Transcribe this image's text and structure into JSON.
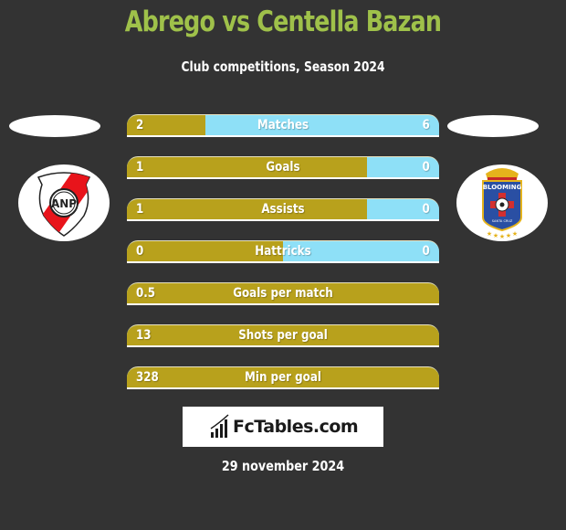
{
  "header": {
    "title": "Abrego vs Centella Bazan",
    "subtitle": "Club competitions, Season 2024"
  },
  "teams": {
    "left": {
      "crest_icon": "club-atletico-nacional-potosi-crest",
      "colors": {
        "primary": "#e8141b",
        "secondary": "#ffffff"
      }
    },
    "right": {
      "crest_icon": "blooming-crest",
      "text": "BLOOMING",
      "colors": {
        "primary": "#2a4fa3",
        "accent": "#d32f2f",
        "gold": "#e5b31c"
      }
    }
  },
  "colors": {
    "background": "#333333",
    "title": "#9fc14a",
    "left_bar": "#b8a11c",
    "right_bar": "#8ee0f7"
  },
  "stats": [
    {
      "label": "Matches",
      "left": "2",
      "right": "6",
      "left_share": 0.25
    },
    {
      "label": "Goals",
      "left": "1",
      "right": "0",
      "left_share": 0.77
    },
    {
      "label": "Assists",
      "left": "1",
      "right": "0",
      "left_share": 0.77
    },
    {
      "label": "Hattricks",
      "left": "0",
      "right": "0",
      "left_share": 0.5
    },
    {
      "label": "Goals per match",
      "left": "0.5",
      "right": "",
      "left_share": 1.0
    },
    {
      "label": "Shots per goal",
      "left": "13",
      "right": "",
      "left_share": 1.0
    },
    {
      "label": "Min per goal",
      "left": "328",
      "right": "",
      "left_share": 1.0
    }
  ],
  "footer": {
    "brand": "FcTables.com",
    "brand_icon": "bar-chart-icon",
    "date": "29 november 2024"
  }
}
